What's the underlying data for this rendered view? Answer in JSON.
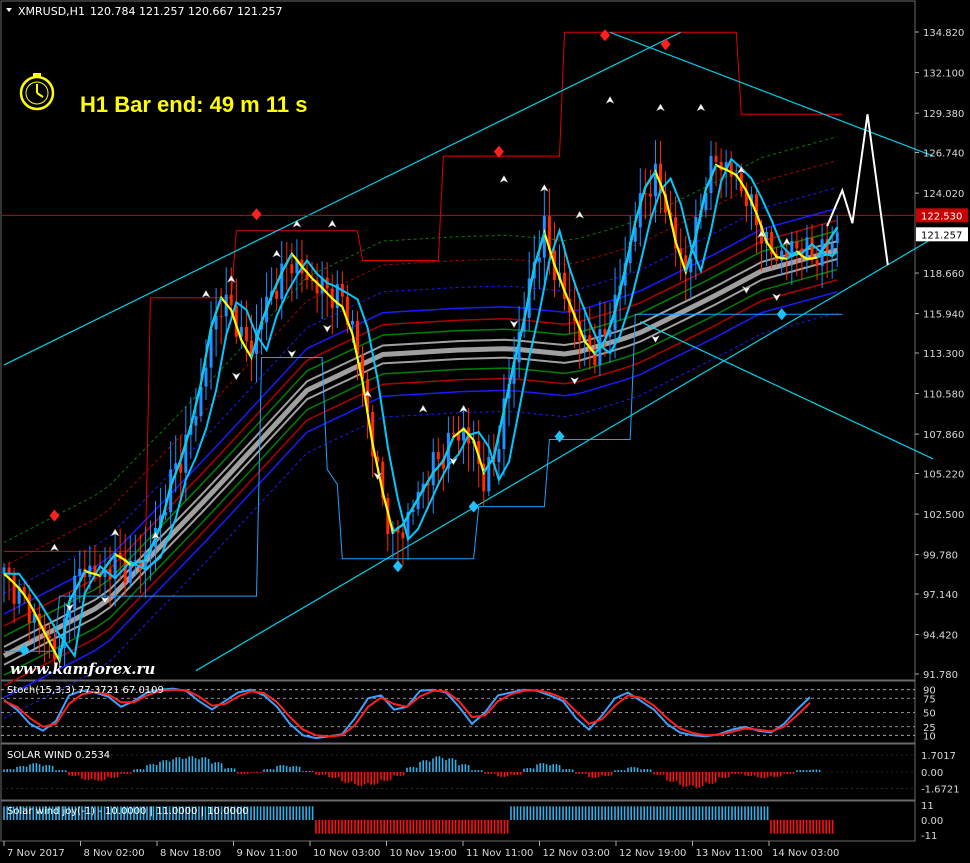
{
  "window": {
    "symbol_title": "XMRUSD,H1",
    "ohlc_readout": "120.784 121.257 120.667 121.257"
  },
  "timer": {
    "text": "H1 Bar end: 49 m 11 s"
  },
  "watermark": "www.kamforex.ru",
  "colors": {
    "background": "#000000",
    "bull_candle": "#1e90ff",
    "bear_candle": "#ff2a00",
    "channel_line": "#00d0e8",
    "donchian_upper": "#e00000",
    "donchian_lower": "#1ea0ff",
    "fast_ma": "#ffff00",
    "mid_ma": "#00c8ff",
    "ribbon_grey": "#a0a0a0",
    "ribbon_green": "#008000",
    "ribbon_red": "#b00000",
    "ribbon_blue": "#1a1aff",
    "price_marker": "#c80000",
    "stoch_main": "#3ca0ff",
    "stoch_signal": "#ff2020",
    "hist_pos": "#30b0e8",
    "hist_neg": "#ff1010"
  },
  "chart_data": [
    {
      "type": "candlestick",
      "title": "XMRUSD,H1",
      "y_axis": {
        "ticks": [
          "134.820",
          "132.100",
          "129.380",
          "126.740",
          "124.020",
          "121.257",
          "118.660",
          "115.940",
          "113.300",
          "110.580",
          "107.860",
          "105.220",
          "102.500",
          "99.780",
          "97.140",
          "94.420",
          "91.780"
        ]
      },
      "horizontal_line": {
        "label": "122.530",
        "value": 122.53
      },
      "current_price": {
        "label": "121.257",
        "value": 121.257
      },
      "x_axis": {
        "ticks": [
          "7 Nov 2017",
          "8 Nov 02:00",
          "8 Nov 18:00",
          "9 Nov 11:00",
          "10 Nov 03:00",
          "10 Nov 19:00",
          "11 Nov 11:00",
          "12 Nov 03:00",
          "12 Nov 19:00",
          "13 Nov 11:00",
          "14 Nov 03:00"
        ]
      },
      "close_path": [
        [
          0,
          98.5
        ],
        [
          4,
          96.6
        ],
        [
          8,
          94.4
        ],
        [
          11,
          93.0
        ],
        [
          13,
          97.2
        ],
        [
          16,
          99.0
        ],
        [
          19,
          98.2
        ],
        [
          22,
          99.3
        ],
        [
          25,
          98.8
        ],
        [
          28,
          99.6
        ],
        [
          31,
          102.2
        ],
        [
          33,
          104.8
        ],
        [
          35,
          106.3
        ],
        [
          37,
          108.2
        ],
        [
          39,
          110.8
        ],
        [
          41,
          114.5
        ],
        [
          43,
          116.7
        ],
        [
          45,
          116.2
        ],
        [
          47,
          114.5
        ],
        [
          49,
          113.5
        ],
        [
          51,
          115.8
        ],
        [
          53,
          117.3
        ],
        [
          55,
          118.5
        ],
        [
          57,
          119.5
        ],
        [
          59,
          118.6
        ],
        [
          61,
          118.0
        ],
        [
          63,
          117.7
        ],
        [
          65,
          117.3
        ],
        [
          67,
          116.9
        ],
        [
          69,
          115.0
        ],
        [
          71,
          111.5
        ],
        [
          73,
          107.0
        ],
        [
          75,
          103.5
        ],
        [
          77,
          100.8
        ],
        [
          79,
          101.5
        ],
        [
          81,
          103.0
        ],
        [
          83,
          104.5
        ],
        [
          85,
          105.8
        ],
        [
          87,
          106.5
        ],
        [
          89,
          107.8
        ],
        [
          91,
          108.0
        ],
        [
          93,
          107.0
        ],
        [
          95,
          104.8
        ],
        [
          97,
          106.0
        ],
        [
          99,
          109.5
        ],
        [
          101,
          113.0
        ],
        [
          103,
          116.0
        ],
        [
          105,
          119.5
        ],
        [
          107,
          121.5
        ],
        [
          109,
          119.0
        ],
        [
          111,
          117.0
        ],
        [
          113,
          115.3
        ],
        [
          115,
          113.8
        ],
        [
          117,
          113.3
        ],
        [
          119,
          114.5
        ],
        [
          121,
          116.6
        ],
        [
          123,
          119.3
        ],
        [
          125,
          122.2
        ],
        [
          127,
          124.2
        ],
        [
          129,
          125.0
        ],
        [
          131,
          123.3
        ],
        [
          133,
          120.5
        ],
        [
          135,
          118.8
        ],
        [
          137,
          121.5
        ],
        [
          139,
          124.8
        ],
        [
          141,
          126.3
        ],
        [
          143,
          125.7
        ],
        [
          145,
          125.0
        ],
        [
          147,
          123.7
        ],
        [
          149,
          122.2
        ],
        [
          151,
          120.5
        ],
        [
          153,
          119.8
        ],
        [
          155,
          120.0
        ],
        [
          157,
          120.6
        ],
        [
          159,
          120.0
        ],
        [
          161,
          119.8
        ],
        [
          163,
          120.4
        ],
        [
          165,
          121.257
        ]
      ],
      "donchian_upper": [
        [
          0,
          100
        ],
        [
          28,
          100
        ],
        [
          29,
          117
        ],
        [
          45,
          117
        ],
        [
          46,
          121.5
        ],
        [
          70,
          121.5
        ],
        [
          71,
          119.5
        ],
        [
          86,
          119.5
        ],
        [
          87,
          126.5
        ],
        [
          110,
          126.5
        ],
        [
          111,
          134.8
        ],
        [
          145,
          134.8
        ],
        [
          146,
          129.3
        ],
        [
          166,
          129.3
        ]
      ],
      "donchian_lower": [
        [
          0,
          93.3
        ],
        [
          10,
          93.3
        ],
        [
          11,
          97.0
        ],
        [
          50,
          97.0
        ],
        [
          51,
          113.0
        ],
        [
          63,
          113.0
        ],
        [
          64,
          105.5
        ],
        [
          66,
          104.5
        ],
        [
          67,
          99.5
        ],
        [
          93,
          99.5
        ],
        [
          94,
          103.0
        ],
        [
          107,
          103.0
        ],
        [
          108,
          107.5
        ],
        [
          124,
          107.5
        ],
        [
          125,
          115.9
        ],
        [
          166,
          115.9
        ]
      ],
      "channel_upper": [
        [
          0,
          112.5
        ],
        [
          134,
          134.8
        ]
      ],
      "channel_lower": [
        [
          38,
          92.0
        ],
        [
          184,
          121.0
        ]
      ],
      "falling_upper": [
        [
          120,
          134.8
        ],
        [
          184,
          126.5
        ]
      ],
      "falling_lower": [
        [
          126,
          115.4
        ],
        [
          184,
          106.2
        ]
      ],
      "projection": [
        [
          163,
          121.8
        ],
        [
          166,
          124.2
        ],
        [
          168,
          122.0
        ],
        [
          171,
          129.3
        ],
        [
          175,
          119.2
        ]
      ],
      "ribbon_mid": [
        [
          0,
          93.0
        ],
        [
          20,
          96.5
        ],
        [
          40,
          103.5
        ],
        [
          60,
          110.8
        ],
        [
          75,
          113.2
        ],
        [
          90,
          113.5
        ],
        [
          100,
          113.6
        ],
        [
          112,
          113.2
        ],
        [
          125,
          114.5
        ],
        [
          140,
          117.0
        ],
        [
          150,
          118.8
        ],
        [
          165,
          120.2
        ]
      ]
    },
    {
      "type": "line",
      "title": "Stoch(15,3,3) 77.3721 67.0109",
      "levels": [
        90,
        75,
        50,
        25,
        10
      ],
      "level_labels": [
        "90",
        "75",
        "50",
        "25",
        "10"
      ],
      "series": [
        {
          "name": "main",
          "values": [
            72,
            55,
            30,
            18,
            35,
            80,
            88,
            85,
            78,
            60,
            70,
            85,
            90,
            92,
            88,
            70,
            55,
            70,
            85,
            90,
            80,
            60,
            30,
            10,
            5,
            8,
            12,
            40,
            75,
            80,
            55,
            60,
            88,
            90,
            85,
            60,
            30,
            50,
            80,
            85,
            90,
            88,
            80,
            70,
            40,
            20,
            45,
            75,
            85,
            70,
            55,
            30,
            15,
            10,
            8,
            12,
            20,
            25,
            18,
            15,
            30,
            55,
            77
          ]
        },
        {
          "name": "signal",
          "values": [
            70,
            60,
            40,
            25,
            30,
            65,
            82,
            86,
            82,
            68,
            68,
            80,
            88,
            90,
            89,
            78,
            62,
            65,
            78,
            87,
            84,
            68,
            42,
            20,
            10,
            8,
            10,
            28,
            60,
            76,
            65,
            60,
            78,
            88,
            87,
            70,
            42,
            45,
            70,
            82,
            88,
            89,
            84,
            75,
            52,
            30,
            38,
            62,
            80,
            76,
            62,
            40,
            22,
            14,
            10,
            11,
            16,
            22,
            20,
            17,
            25,
            45,
            67
          ]
        }
      ]
    },
    {
      "type": "histogram",
      "title": "SOLAR WIND 0.2534",
      "levels": [
        1.7017,
        0.0,
        -1.6721
      ],
      "level_labels": [
        "1.7017",
        "0.00",
        "-1.6721"
      ],
      "values": [
        0.3,
        0.6,
        0.9,
        0.7,
        0.2,
        -0.4,
        -0.8,
        -0.9,
        -0.6,
        -0.2,
        0.3,
        0.8,
        1.2,
        1.5,
        1.6,
        1.5,
        1.0,
        0.4,
        -0.2,
        -0.1,
        0.3,
        0.7,
        0.6,
        0.1,
        -0.3,
        -0.6,
        -1.1,
        -1.4,
        -1.3,
        -0.9,
        -0.4,
        0.5,
        1.2,
        1.6,
        1.4,
        0.8,
        0.2,
        -0.2,
        -0.5,
        -0.3,
        0.4,
        0.9,
        0.8,
        0.3,
        -0.2,
        -0.6,
        -0.4,
        0.2,
        0.5,
        0.3,
        -0.3,
        -1.0,
        -1.5,
        -1.6,
        -1.2,
        -0.6,
        -0.2,
        -0.4,
        -0.6,
        -0.5,
        -0.2,
        0.2,
        0.25
      ]
    },
    {
      "type": "histogram",
      "title": "Solar wind joy(-1) - 10.0000 | 11.0000 | 10.0000",
      "levels": [
        11,
        0.0,
        -11
      ],
      "level_labels": [
        "11",
        "0.00",
        "-11"
      ],
      "values": [
        10,
        10,
        10,
        10,
        10,
        10,
        10,
        10,
        10,
        10,
        10,
        10,
        10,
        10,
        10,
        10,
        10,
        10,
        10,
        10,
        10,
        10,
        10,
        10,
        -10,
        -10,
        -10,
        -10,
        -10,
        -10,
        -10,
        -10,
        -10,
        -10,
        -10,
        -10,
        -10,
        -10,
        -10,
        10,
        10,
        10,
        10,
        10,
        10,
        10,
        10,
        10,
        10,
        10,
        10,
        10,
        10,
        10,
        10,
        10,
        10,
        10,
        10,
        -10,
        -10,
        -10,
        -10,
        -10
      ]
    }
  ]
}
